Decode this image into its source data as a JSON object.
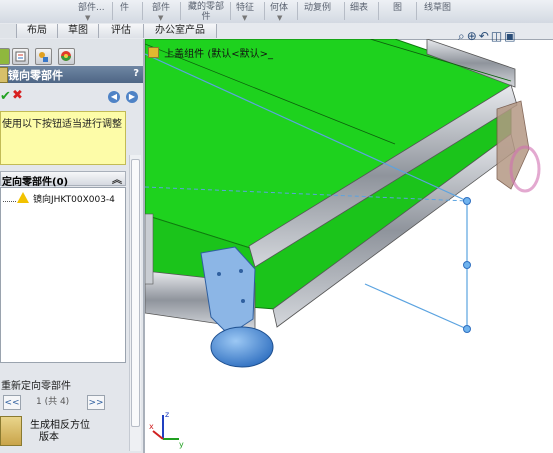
{
  "toolbar_top": {
    "labels": [
      "部件...",
      "件",
      "部件",
      "藏的零部件",
      "特征",
      "何体",
      "动复例",
      "细表",
      "图",
      "线草图"
    ]
  },
  "tabs": [
    "布局",
    "草图",
    "评估",
    "办公室产品"
  ],
  "property_manager": {
    "title": "镜向零部件",
    "help": "?",
    "message": "使用以下按钮适当进行调整",
    "section_title": "定向零部件(0)",
    "list_items": [
      "镜向JHKT00X003-4"
    ],
    "bottom_label": "重新定向零部件",
    "page_indicator": "1 (共 4)",
    "prev_label": "<<",
    "next_label": ">>",
    "flip_label_line1": "生成相反方位",
    "flip_label_line2": "版本"
  },
  "viewport": {
    "breadcrumb": "上盖组件  (默认<默认>_",
    "view_toolbar_icons": [
      "zoom-fit-icon",
      "zoom-area-icon",
      "previous-view-icon",
      "section-view-icon",
      "view-orientation-icon"
    ],
    "triad_axes": [
      "x",
      "y",
      "z"
    ]
  },
  "colors": {
    "model_green": "#1ed21e",
    "frame_gray": "#b8bcc4",
    "selection_blue": "#5ba3e0",
    "foot_blue": "#4f8fd9",
    "panel_header": "#5a7394"
  }
}
